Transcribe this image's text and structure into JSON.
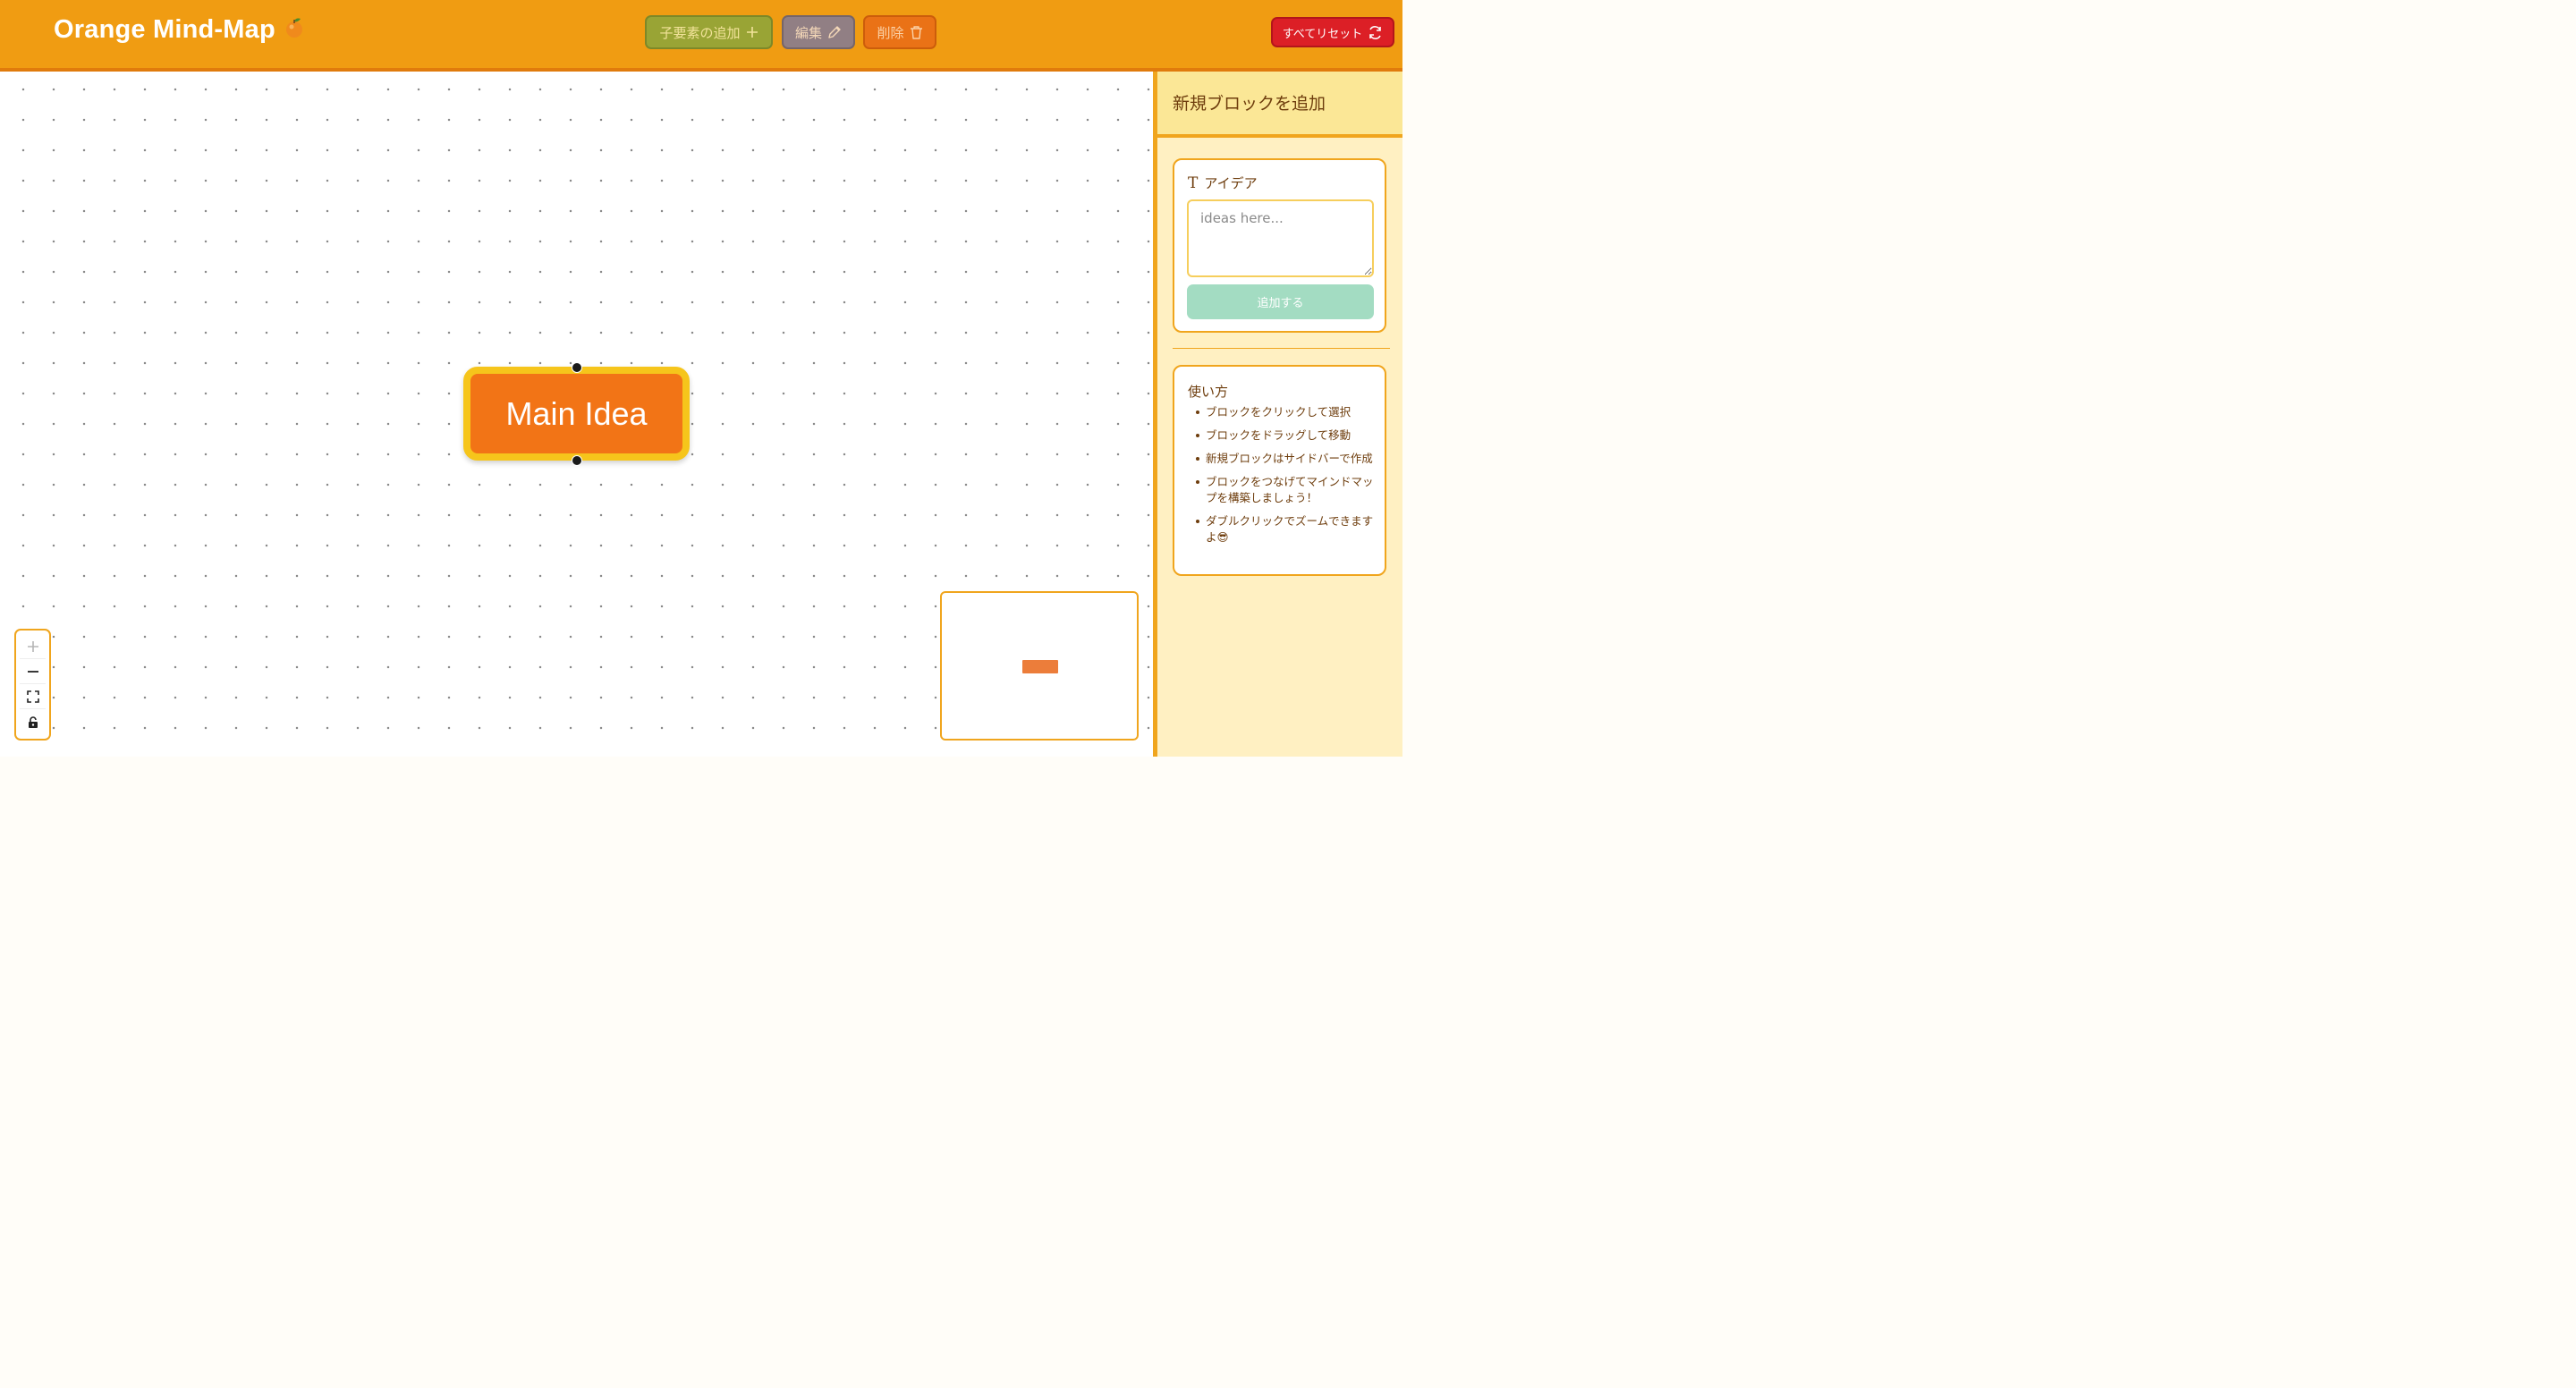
{
  "header": {
    "title": "Orange Mind-Map",
    "title_emoji": "🍊",
    "buttons": {
      "add_child": "子要素の追加",
      "edit": "編集",
      "delete": "削除",
      "reset_all": "すべてリセット"
    },
    "colors": {
      "header_bg": "#f09c12",
      "add_child": "#99a435",
      "edit": "#917f84",
      "delete": "#ea7216",
      "reset": "#dc1f26"
    }
  },
  "canvas": {
    "node": {
      "label": "Main Idea",
      "fill": "#f27416",
      "border": "#f6c51b"
    },
    "controls": [
      "plus-icon",
      "minus-icon",
      "fit-view-icon",
      "lock-icon"
    ],
    "minimap": {
      "node_color": "#ec7d3a"
    }
  },
  "sidebar": {
    "title": "新規ブロックを追加",
    "form": {
      "label": "アイデア",
      "label_icon": "text-type-icon",
      "input_value": "",
      "input_placeholder": "ideas here...",
      "submit_label": "追加する",
      "submit_color": "#a3dcc2"
    },
    "help": {
      "title": "使い方",
      "items": [
        "ブロックをクリックして選択",
        "ブロックをドラッグして移動",
        "新規ブロックはサイドバーで作成",
        "ブロックをつなげてマインドマップを構築しましょう！",
        "ダブルクリックでズームできますよ😎"
      ]
    }
  }
}
